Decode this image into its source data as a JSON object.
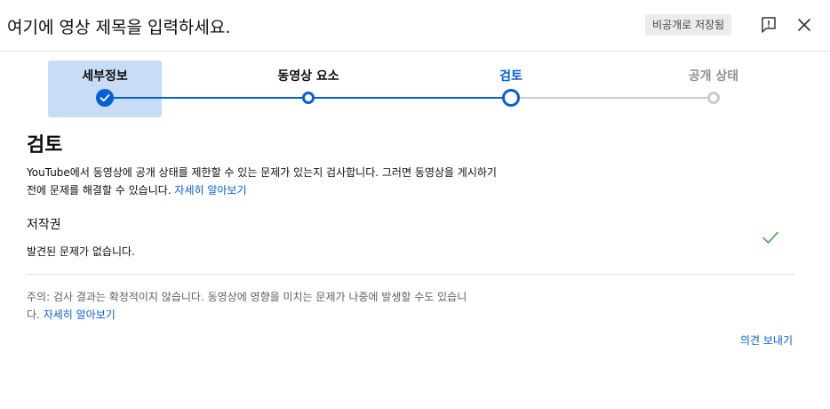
{
  "header": {
    "title": "여기에 영상 제목을 입력하세요.",
    "save_status": "비공개로 저장됨",
    "feedback_icon": "report-icon",
    "close_icon": "close-icon"
  },
  "stepper": {
    "steps": [
      {
        "label": "세부정보",
        "state": "done"
      },
      {
        "label": "동영상 요소",
        "state": "done"
      },
      {
        "label": "검토",
        "state": "current"
      },
      {
        "label": "공개 상태",
        "state": "pending"
      }
    ],
    "colors": {
      "active": "#065fd4",
      "inactive": "#cccccc",
      "current_label": "#065fd4",
      "pending_label": "#909090",
      "highlight_bg": "#c9dcf6"
    }
  },
  "main": {
    "heading": "검토",
    "description": "YouTube에서 동영상에 공개 상태를 제한할 수 있는 문제가 있는지 검사합니다. 그러면 동영상을 게시하기 전에 문제를 해결할 수 있습니다.",
    "learn_more": "자세히 알아보기",
    "copyright": {
      "title": "저작권",
      "status": "발견된 문제가 없습니다.",
      "status_icon": "check-icon",
      "status_color": "#2ba640"
    },
    "note": "주의: 검사 결과는 확정적이지 않습니다. 동영상에 영향을 미치는 문제가 나중에 발생할 수도 있습니다.",
    "note_learn_more": "자세히 알아보기",
    "send_feedback": "의견 보내기"
  }
}
